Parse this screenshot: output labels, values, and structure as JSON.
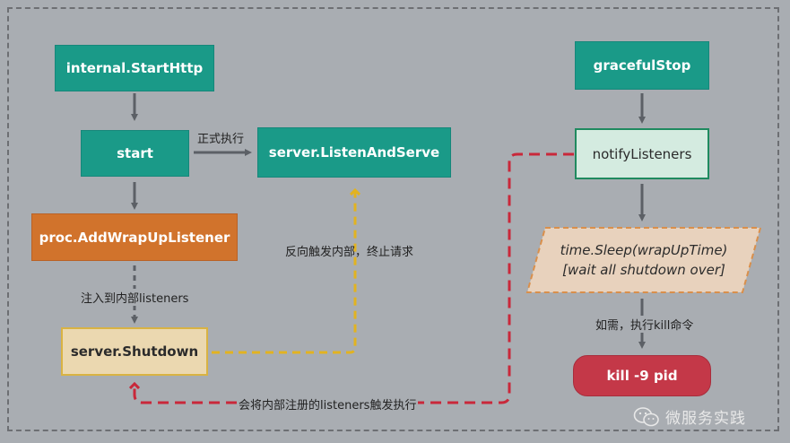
{
  "nodes": {
    "internal_start_http": "internal.StartHttp",
    "start": "start",
    "listen_and_serve": "server.ListenAndServe",
    "add_wrapup_listener": "proc.AddWrapUpListener",
    "server_shutdown": "server.Shutdown",
    "graceful_stop": "gracefulStop",
    "notify_listeners": "notifyListeners",
    "sleep_line1": "time.Sleep(wrapUpTime)",
    "sleep_line2": "[wait all shutdown over]",
    "kill": "kill -9 pid"
  },
  "labels": {
    "formal_exec": "正式执行",
    "reverse_trigger": "反向触发内部，终止请求",
    "inject": "注入到内部listeners",
    "trigger_registered": "会将内部注册的listeners触发执行",
    "if_needed_kill": "如需，执行kill命令"
  },
  "watermark": {
    "text": "微服务实践",
    "icon": "wechat-icon"
  },
  "colors": {
    "teal": "#1a9a88",
    "orange": "#d1732c",
    "yellow_border": "#d9b343",
    "red": "#c43848",
    "arrow": "#5c6066",
    "dashed_red": "#c9283a",
    "dashed_yellow": "#e2b320"
  }
}
